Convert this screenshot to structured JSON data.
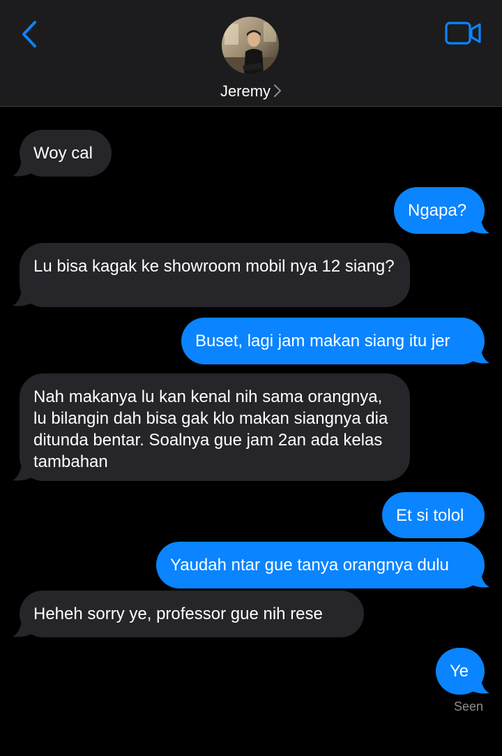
{
  "header": {
    "contact_name": "Jeremy",
    "back_icon": "chevron-left-icon",
    "video_icon": "video-camera-icon",
    "accent_color": "#0a84ff"
  },
  "messages": [
    {
      "direction": "incoming",
      "text": "Woy cal"
    },
    {
      "direction": "outgoing",
      "text": "Ngapa?"
    },
    {
      "direction": "incoming",
      "text": "Lu bisa kagak ke showroom mobil nya 12 siang?"
    },
    {
      "direction": "outgoing",
      "text": "Buset, lagi jam makan siang itu jer"
    },
    {
      "direction": "incoming",
      "text": "Nah makanya lu kan kenal nih sama orangnya, lu bilangin dah bisa gak klo makan siangnya dia ditunda bentar. Soalnya gue jam 2an ada kelas tambahan"
    },
    {
      "direction": "outgoing",
      "text": "Et si tolol"
    },
    {
      "direction": "outgoing",
      "text": "Yaudah ntar gue tanya orangnya dulu"
    },
    {
      "direction": "incoming",
      "text": "Heheh sorry ye, professor gue nih rese"
    },
    {
      "direction": "outgoing",
      "text": "Ye"
    }
  ],
  "status": {
    "read_receipt": "Seen"
  },
  "colors": {
    "incoming_bubble": "#26252a",
    "outgoing_bubble": "#0a84ff",
    "header_bg": "#1c1c1e"
  }
}
